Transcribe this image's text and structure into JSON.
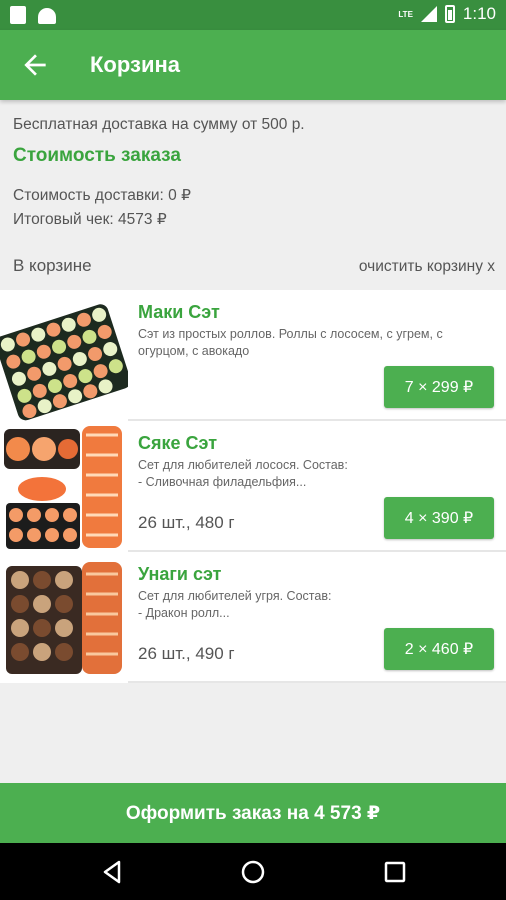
{
  "status_bar": {
    "time": "1:10",
    "network": "LTE"
  },
  "app_bar": {
    "title": "Корзина"
  },
  "summary": {
    "free_delivery": "Бесплатная доставка на сумму от 500 р.",
    "cost_title": "Стоимость заказа",
    "delivery_cost": "Стоимость доставки: 0 ₽",
    "total": "Итоговый чек: 4573 ₽"
  },
  "cart": {
    "label": "В корзине",
    "clear": "очистить корзину x",
    "items": [
      {
        "name": "Маки Сэт",
        "desc": "Сэт из простых роллов. Роллы с лососем, с угрем, с огурцом, с авокадо",
        "meta": "",
        "price": "7 × 299 ₽"
      },
      {
        "name": "Сяке Сэт",
        "desc": "Сет для любителей лосося. Состав:\n- Сливочная филадельфия...",
        "meta": "26 шт., 480 г",
        "price": "4 × 390 ₽"
      },
      {
        "name": "Унаги сэт",
        "desc": "Сет для любителей угря. Состав:\n- Дракон ролл...",
        "meta": "26 шт., 490 г",
        "price": "2 × 460 ₽"
      }
    ]
  },
  "checkout": {
    "label": "Оформить заказ на 4 573 ₽"
  },
  "colors": {
    "primary": "#4caf50",
    "status": "#398f3f",
    "accent_text": "#3aa43e"
  },
  "icons": [
    "back-arrow-icon",
    "nav-back-icon",
    "nav-home-icon",
    "nav-recents-icon"
  ]
}
